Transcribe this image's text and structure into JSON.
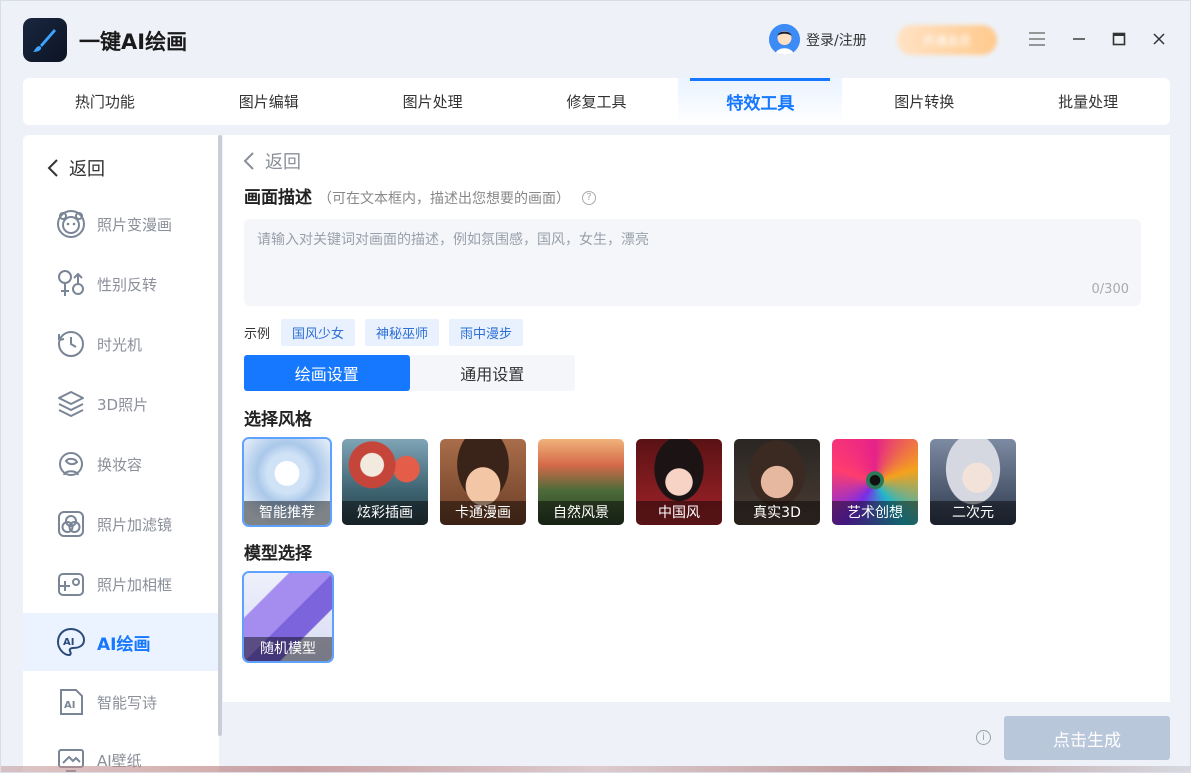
{
  "app": {
    "title": "一键AI绘画"
  },
  "header": {
    "login_label": "登录/注册",
    "vip_label": "开通会员"
  },
  "tabs": [
    {
      "label": "热门功能"
    },
    {
      "label": "图片编辑"
    },
    {
      "label": "图片处理"
    },
    {
      "label": "修复工具"
    },
    {
      "label": "特效工具",
      "active": true
    },
    {
      "label": "图片转换"
    },
    {
      "label": "批量处理"
    }
  ],
  "sidebar": {
    "back_label": "返回",
    "items": [
      {
        "label": "照片变漫画",
        "icon": "cartoon-face-icon"
      },
      {
        "label": "性别反转",
        "icon": "gender-icon"
      },
      {
        "label": "时光机",
        "icon": "clock-icon"
      },
      {
        "label": "3D照片",
        "icon": "layers-icon"
      },
      {
        "label": "换妆容",
        "icon": "makeup-icon"
      },
      {
        "label": "照片加滤镜",
        "icon": "filter-icon"
      },
      {
        "label": "照片加相框",
        "icon": "frame-icon"
      },
      {
        "label": "AI绘画",
        "icon": "ai-paint-icon",
        "active": true
      },
      {
        "label": "智能写诗",
        "icon": "ai-poem-icon"
      },
      {
        "label": "AI壁纸",
        "icon": "wallpaper-icon"
      }
    ]
  },
  "main": {
    "back_label": "返回",
    "description_title": "画面描述",
    "description_hint": "（可在文本框内，描述出您想要的画面）",
    "prompt_placeholder": "请输入对关键词对画面的描述，例如氛围感，国风，女生，漂亮",
    "prompt_value": "",
    "counter": "0/300",
    "examples_label": "示例",
    "examples": [
      "国风少女",
      "神秘巫师",
      "雨中漫步"
    ],
    "settings_tabs": [
      {
        "label": "绘画设置",
        "active": true
      },
      {
        "label": "通用设置"
      }
    ],
    "style_title": "选择风格",
    "styles": [
      {
        "label": "智能推荐",
        "selected": true
      },
      {
        "label": "炫彩插画"
      },
      {
        "label": "卡通漫画"
      },
      {
        "label": "自然风景"
      },
      {
        "label": "中国风"
      },
      {
        "label": "真实3D"
      },
      {
        "label": "艺术创想"
      },
      {
        "label": "二次元"
      }
    ],
    "model_title": "模型选择",
    "model": {
      "label": "随机模型"
    }
  },
  "footer": {
    "generate_label": "点击生成",
    "info_icon": "i"
  }
}
